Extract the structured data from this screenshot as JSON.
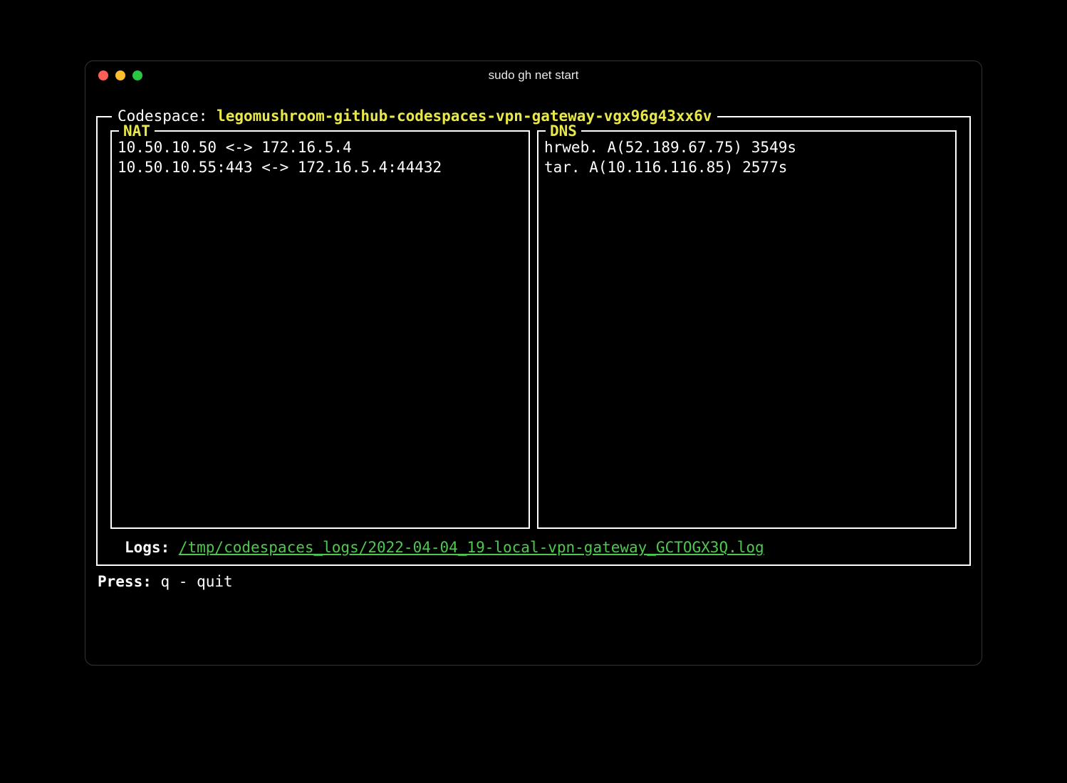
{
  "window": {
    "title": "sudo gh net start"
  },
  "codespace": {
    "label": "Codespace: ",
    "name": "legomushroom-github-codespaces-vpn-gateway-vgx96g43xx6v"
  },
  "panels": {
    "nat": {
      "title": "NAT",
      "lines": [
        "10.50.10.50 <-> 172.16.5.4",
        "10.50.10.55:443 <-> 172.16.5.4:44432"
      ]
    },
    "dns": {
      "title": "DNS",
      "lines": [
        "hrweb. A(52.189.67.75) 3549s",
        "tar. A(10.116.116.85) 2577s"
      ]
    }
  },
  "logs": {
    "label": "Logs: ",
    "path": "/tmp/codespaces_logs/2022-04-04_19-local-vpn-gateway_GCTOGX3Q.log"
  },
  "press": {
    "label": "Press: ",
    "value": "q - quit"
  }
}
